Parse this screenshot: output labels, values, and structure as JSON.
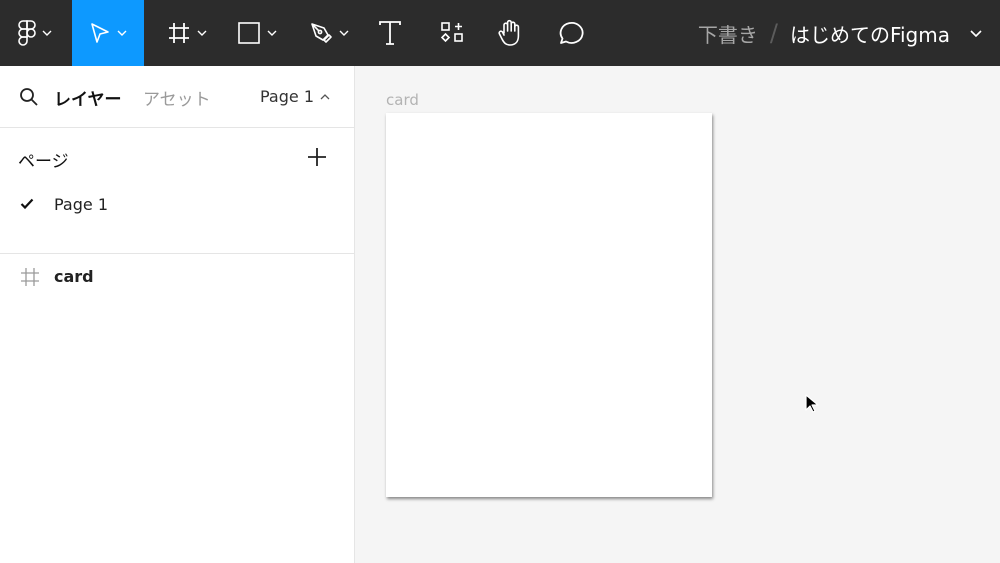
{
  "toolbar": {
    "tools": [
      "main-menu",
      "move",
      "frame",
      "rectangle",
      "pen",
      "text",
      "resources",
      "hand",
      "comment"
    ],
    "active_tool": "move",
    "accent_color": "#0d99ff",
    "background_color": "#2c2c2c",
    "breadcrumb": {
      "folder": "下書き",
      "separator": "/",
      "file_name": "はじめてのFigma"
    }
  },
  "left_panel": {
    "tabs": {
      "layers_label": "レイヤー",
      "assets_label": "アセット"
    },
    "current_page": "Page 1",
    "pages_section": {
      "title": "ページ",
      "items": [
        {
          "label": "Page 1",
          "selected": true
        }
      ]
    },
    "layers": [
      {
        "label": "card",
        "type": "frame",
        "icon": "frame-icon"
      }
    ]
  },
  "canvas": {
    "frame_label": "card",
    "background_color": "#f5f5f5"
  }
}
